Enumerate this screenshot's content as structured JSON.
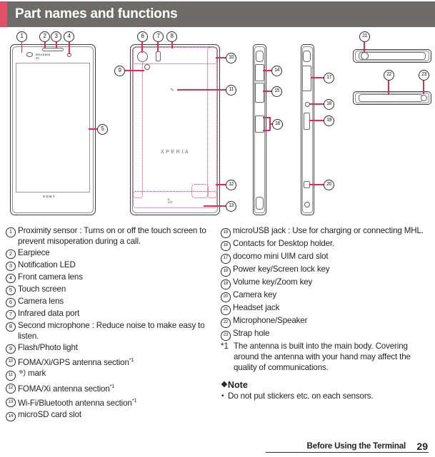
{
  "header": {
    "title": "Part names and functions",
    "accent_color": "#e05069",
    "bar_color": "#6e6b6b"
  },
  "diagram": {
    "front_brand_top": "docomo Xi",
    "front_brand_bottom": "SONY",
    "back_brand": "XPERIA",
    "back_brand_small": "X-4TT",
    "callouts": [
      "1",
      "2",
      "3",
      "4",
      "5",
      "6",
      "7",
      "8",
      "9",
      "10",
      "11",
      "12",
      "13",
      "14",
      "15",
      "16",
      "17",
      "18",
      "19",
      "20",
      "21",
      "22",
      "23"
    ],
    "antenna_color": "#e5275a"
  },
  "parts_left": [
    {
      "num": "1",
      "text": "Proximity sensor : Turns on or off the touch screen to prevent misoperation during a call."
    },
    {
      "num": "2",
      "text": "Earpiece"
    },
    {
      "num": "3",
      "text": "Notification LED"
    },
    {
      "num": "4",
      "text": "Front camera lens"
    },
    {
      "num": "5",
      "text": "Touch screen"
    },
    {
      "num": "6",
      "text": "Camera lens"
    },
    {
      "num": "7",
      "text": "Infrared data port"
    },
    {
      "num": "8",
      "text": "Second microphone : Reduce noise to make easy to listen."
    },
    {
      "num": "9",
      "text": "Flash/Photo light"
    },
    {
      "num": "10",
      "text": "FOMA/Xi/GPS antenna section",
      "sup": "*1"
    },
    {
      "num": "11",
      "text": "mark",
      "glyph": "nfc-mark"
    },
    {
      "num": "12",
      "text": "FOMA/Xi antenna section",
      "sup": "*1"
    },
    {
      "num": "13",
      "text": "Wi-Fi/Bluetooth antenna section",
      "sup": "*1"
    },
    {
      "num": "14",
      "text": "microSD card slot"
    }
  ],
  "parts_right": [
    {
      "num": "15",
      "text": "microUSB jack : Use for charging or connecting MHL."
    },
    {
      "num": "16",
      "text": "Contacts for Desktop holder."
    },
    {
      "num": "17",
      "text": "docomo mini UIM card slot"
    },
    {
      "num": "18",
      "text": "Power key/Screen lock key"
    },
    {
      "num": "19",
      "text": "Volume key/Zoom key"
    },
    {
      "num": "20",
      "text": "Camera key"
    },
    {
      "num": "21",
      "text": "Headset jack"
    },
    {
      "num": "22",
      "text": "Microphone/Speaker"
    },
    {
      "num": "23",
      "text": "Strap hole"
    }
  ],
  "footnote": {
    "mark": "*1",
    "text": "The antenna is built into the main body. Covering around the antenna with your hand may affect the quality of communications."
  },
  "note": {
    "diamond": "❖",
    "heading": "Note",
    "bullet": "•",
    "items": [
      "Do not put stickers etc. on each sensors."
    ]
  },
  "footer": {
    "title": "Before Using the Terminal",
    "page": "29"
  }
}
